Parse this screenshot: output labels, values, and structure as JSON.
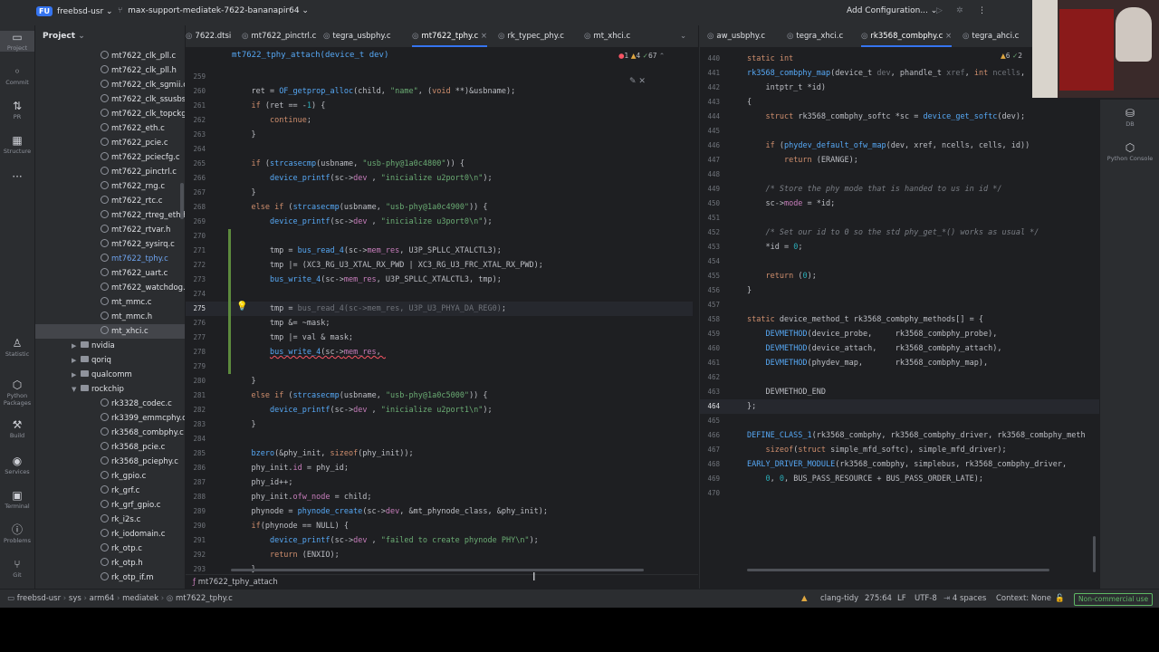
{
  "titlebar": {
    "app_badge": "FU",
    "project": "freebsd-usr",
    "branch": "max-support-mediatek-7622-bananapir64",
    "run_config": "Add Configuration..."
  },
  "left_sidebar": {
    "items": [
      {
        "label": "Project",
        "icon": "folder-icon"
      },
      {
        "label": "Commit",
        "icon": "commit-icon"
      },
      {
        "label": "PR",
        "icon": "pull-request-icon"
      },
      {
        "label": "Structure",
        "icon": "structure-icon"
      },
      {
        "label": "",
        "icon": "more-icon"
      },
      {
        "label": "Statistic",
        "icon": "statistic-icon"
      },
      {
        "label": "Python Packages",
        "icon": "python-packages-icon"
      },
      {
        "label": "Build",
        "icon": "build-icon"
      },
      {
        "label": "Services",
        "icon": "services-icon"
      },
      {
        "label": "Terminal",
        "icon": "terminal-icon"
      },
      {
        "label": "Problems",
        "icon": "problems-icon"
      },
      {
        "label": "Git",
        "icon": "git-icon"
      }
    ]
  },
  "right_sidebar": {
    "items": [
      {
        "label": "DB",
        "icon": "database-icon"
      },
      {
        "label": "Python Console",
        "icon": "python-console-icon"
      }
    ]
  },
  "project_panel": {
    "title": "Project",
    "rows": [
      {
        "label": "mt7622_clk_pll.c",
        "kind": "file",
        "indent": 1
      },
      {
        "label": "mt7622_clk_pll.h",
        "kind": "file",
        "indent": 1
      },
      {
        "label": "mt7622_clk_sgmii.c",
        "kind": "file",
        "indent": 1
      },
      {
        "label": "mt7622_clk_ssusbsys",
        "kind": "file",
        "indent": 1
      },
      {
        "label": "mt7622_clk_topckgen",
        "kind": "file",
        "indent": 1
      },
      {
        "label": "mt7622_eth.c",
        "kind": "file",
        "indent": 1
      },
      {
        "label": "mt7622_pcie.c",
        "kind": "file",
        "indent": 1
      },
      {
        "label": "mt7622_pciecfg.c",
        "kind": "file",
        "indent": 1
      },
      {
        "label": "mt7622_pinctrl.c",
        "kind": "file",
        "indent": 1
      },
      {
        "label": "mt7622_rng.c",
        "kind": "file",
        "indent": 1
      },
      {
        "label": "mt7622_rtc.c",
        "kind": "file",
        "indent": 1
      },
      {
        "label": "mt7622_rtreg_eth.h",
        "kind": "file",
        "indent": 1
      },
      {
        "label": "mt7622_rtvar.h",
        "kind": "file",
        "indent": 1
      },
      {
        "label": "mt7622_sysirq.c",
        "kind": "file",
        "indent": 1
      },
      {
        "label": "mt7622_tphy.c",
        "kind": "file",
        "indent": 1,
        "highlight": true
      },
      {
        "label": "mt7622_uart.c",
        "kind": "file",
        "indent": 1
      },
      {
        "label": "mt7622_watchdog.c",
        "kind": "file",
        "indent": 1
      },
      {
        "label": "mt_mmc.c",
        "kind": "file",
        "indent": 1
      },
      {
        "label": "mt_mmc.h",
        "kind": "file",
        "indent": 1
      },
      {
        "label": "mt_xhci.c",
        "kind": "file",
        "indent": 1,
        "selected": true
      },
      {
        "label": "nvidia",
        "kind": "dir",
        "indent": 0,
        "chev": "▶"
      },
      {
        "label": "qoriq",
        "kind": "dir",
        "indent": 0,
        "chev": "▶"
      },
      {
        "label": "qualcomm",
        "kind": "dir",
        "indent": 0,
        "chev": "▶"
      },
      {
        "label": "rockchip",
        "kind": "dir",
        "indent": 0,
        "chev": "▼"
      },
      {
        "label": "rk3328_codec.c",
        "kind": "file",
        "indent": 1
      },
      {
        "label": "rk3399_emmcphy.c",
        "kind": "file",
        "indent": 1
      },
      {
        "label": "rk3568_combphy.c",
        "kind": "file",
        "indent": 1
      },
      {
        "label": "rk3568_pcie.c",
        "kind": "file",
        "indent": 1
      },
      {
        "label": "rk3568_pciephy.c",
        "kind": "file",
        "indent": 1
      },
      {
        "label": "rk_gpio.c",
        "kind": "file",
        "indent": 1
      },
      {
        "label": "rk_grf.c",
        "kind": "file",
        "indent": 1
      },
      {
        "label": "rk_grf_gpio.c",
        "kind": "file",
        "indent": 1
      },
      {
        "label": "rk_i2s.c",
        "kind": "file",
        "indent": 1
      },
      {
        "label": "rk_iodomain.c",
        "kind": "file",
        "indent": 1
      },
      {
        "label": "rk_otp.c",
        "kind": "file",
        "indent": 1
      },
      {
        "label": "rk_otp.h",
        "kind": "file",
        "indent": 1
      },
      {
        "label": "rk_otp_if.m",
        "kind": "file",
        "indent": 1
      }
    ]
  },
  "left_editor": {
    "tabs": [
      {
        "label": "7622.dtsi",
        "active": false
      },
      {
        "label": "mt7622_pinctrl.c",
        "active": false
      },
      {
        "label": "tegra_usbphy.c",
        "active": false
      },
      {
        "label": "mt7622_tphy.c",
        "active": true
      },
      {
        "label": "rk_typec_phy.c",
        "active": false
      },
      {
        "label": "mt_xhci.c",
        "active": false
      }
    ],
    "breadcrumb": "mt7622_tphy_attach(device_t dev)",
    "inspections": {
      "errors": "1",
      "warnings": "4",
      "weak": "67"
    },
    "lines": [
      {
        "n": "259",
        "html": ""
      },
      {
        "n": "260",
        "html": "    ret = <span class=\"fn\">OF_getprop_alloc</span>(child, <span class=\"str\">\"name\"</span>, (<span class=\"kw\">void</span> **)&amp;usbname);"
      },
      {
        "n": "261",
        "html": "    <span class=\"kw\">if</span> (ret == -<span class=\"num\">1</span>) {"
      },
      {
        "n": "262",
        "html": "        <span class=\"kw\">continue</span>;"
      },
      {
        "n": "263",
        "html": "    }"
      },
      {
        "n": "264",
        "html": ""
      },
      {
        "n": "265",
        "html": "    <span class=\"kw\">if</span> (<span class=\"fn\">strcasecmp</span>(usbname, <span class=\"str\">\"usb-phy@1a0c4800\"</span>)) {"
      },
      {
        "n": "266",
        "html": "        <span class=\"fn\">device_printf</span>(sc-&gt;<span class=\"fld\">dev</span> , <span class=\"str\">\"inicialize u2port0\\n\"</span>);"
      },
      {
        "n": "267",
        "html": "    }"
      },
      {
        "n": "268",
        "html": "    <span class=\"kw\">else if</span> (<span class=\"fn\">strcasecmp</span>(usbname, <span class=\"str\">\"usb-phy@1a0c4900\"</span>)) {"
      },
      {
        "n": "269",
        "html": "        <span class=\"fn\">device_printf</span>(sc-&gt;<span class=\"fld\">dev</span> , <span class=\"str\">\"inicialize u3port0\\n\"</span>);"
      },
      {
        "n": "270",
        "html": ""
      },
      {
        "n": "271",
        "html": "        tmp = <span class=\"fn\">bus_read_4</span>(sc-&gt;<span class=\"fld\">mem_res</span>, U3P_SPLLC_XTALCTL3);"
      },
      {
        "n": "272",
        "html": "        tmp |= (XC3_RG_U3_XTAL_RX_PWD | XC3_RG_U3_FRC_XTAL_RX_PWD);"
      },
      {
        "n": "273",
        "html": "        <span class=\"fn\">bus_write_4</span>(sc-&gt;<span class=\"fld\">mem_res</span>, U3P_SPLLC_XTALCTL3, tmp);"
      },
      {
        "n": "274",
        "html": ""
      },
      {
        "n": "275",
        "html": "        tmp = <span class=\"dim\">bus_read_4(sc-&gt;mem_res, U3P_U3_PHYA_DA_REG0)</span>;",
        "current": true
      },
      {
        "n": "276",
        "html": "        tmp &amp;= ~mask;"
      },
      {
        "n": "277",
        "html": "        tmp |= val &amp; mask;"
      },
      {
        "n": "278",
        "html": "        <span class=\"err\"><span class=\"fn\">bus_write_4</span>(sc-&gt;<span class=\"fld\">mem_res</span>, </span>"
      },
      {
        "n": "279",
        "html": ""
      },
      {
        "n": "280",
        "html": "    }"
      },
      {
        "n": "281",
        "html": "    <span class=\"kw\">else if</span> (<span class=\"fn\">strcasecmp</span>(usbname, <span class=\"str\">\"usb-phy@1a0c5000\"</span>)) {"
      },
      {
        "n": "282",
        "html": "        <span class=\"fn\">device_printf</span>(sc-&gt;<span class=\"fld\">dev</span> , <span class=\"str\">\"inicialize u2port1\\n\"</span>);"
      },
      {
        "n": "283",
        "html": "    }"
      },
      {
        "n": "284",
        "html": ""
      },
      {
        "n": "285",
        "html": "    <span class=\"fn\">bzero</span>(&amp;phy_init, <span class=\"kw\">sizeof</span>(phy_init));"
      },
      {
        "n": "286",
        "html": "    phy_init.<span class=\"fld\">id</span> = phy_id;"
      },
      {
        "n": "287",
        "html": "    phy_id++;"
      },
      {
        "n": "288",
        "html": "    phy_init.<span class=\"fld\">ofw_node</span> = child;"
      },
      {
        "n": "289",
        "html": "    phynode = <span class=\"fn\">phynode_create</span>(sc-&gt;<span class=\"fld\">dev</span>, &amp;mt_phynode_class, &amp;phy_init);"
      },
      {
        "n": "290",
        "html": "    <span class=\"kw\">if</span>(phynode == NULL) {"
      },
      {
        "n": "291",
        "html": "        <span class=\"fn\">device_printf</span>(sc-&gt;<span class=\"fld\">dev</span> , <span class=\"str\">\"failed to create phynode PHY\\n\"</span>);"
      },
      {
        "n": "292",
        "html": "        <span class=\"kw\">return</span> (ENXIO);"
      },
      {
        "n": "293",
        "html": "    }"
      }
    ],
    "footer_crumb": "mt7622_tphy_attach"
  },
  "right_editor": {
    "tabs": [
      {
        "label": "aw_usbphy.c",
        "active": false
      },
      {
        "label": "tegra_xhci.c",
        "active": false
      },
      {
        "label": "rk3568_combphy.c",
        "active": true
      },
      {
        "label": "tegra_ahci.c",
        "active": false
      }
    ],
    "inspections": {
      "warnings": "6",
      "weak": "2"
    },
    "lines": [
      {
        "n": "440",
        "html": "<span class=\"kw\">static int</span>"
      },
      {
        "n": "441",
        "html": "<span class=\"fn\">rk3568_combphy_map</span>(device_t <span class=\"dim\">dev</span>, phandle_t <span class=\"dim\">xref</span>, <span class=\"kw\">int</span> <span class=\"dim\">ncells</span>,"
      },
      {
        "n": "442",
        "html": "    intptr_t *id)"
      },
      {
        "n": "443",
        "html": "{"
      },
      {
        "n": "444",
        "html": "    <span class=\"kw\">struct</span> rk3568_combphy_softc *sc = <span class=\"fn\">device_get_softc</span>(dev);"
      },
      {
        "n": "445",
        "html": ""
      },
      {
        "n": "446",
        "html": "    <span class=\"kw\">if</span> (<span class=\"fn\">phydev_default_ofw_map</span>(dev, xref, ncells, cells, id))"
      },
      {
        "n": "447",
        "html": "        <span class=\"kw\">return</span> (ERANGE);"
      },
      {
        "n": "448",
        "html": ""
      },
      {
        "n": "449",
        "html": "    <span class=\"cm\">/* Store the phy mode that is handed to us in id */</span>"
      },
      {
        "n": "450",
        "html": "    sc-&gt;<span class=\"fld\">mode</span> = *id;"
      },
      {
        "n": "451",
        "html": ""
      },
      {
        "n": "452",
        "html": "    <span class=\"cm\">/* Set our id to 0 so the std phy_get_*() works as usual */</span>"
      },
      {
        "n": "453",
        "html": "    *id = <span class=\"num\">0</span>;"
      },
      {
        "n": "454",
        "html": ""
      },
      {
        "n": "455",
        "html": "    <span class=\"kw\">return</span> (<span class=\"num\">0</span>);"
      },
      {
        "n": "456",
        "html": "}"
      },
      {
        "n": "457",
        "html": ""
      },
      {
        "n": "458",
        "html": "<span class=\"kw\">static</span> device_method_t rk3568_combphy_methods[] = {"
      },
      {
        "n": "459",
        "html": "    <span class=\"fn\">DEVMETHOD</span>(device_probe,     rk3568_combphy_probe),"
      },
      {
        "n": "460",
        "html": "    <span class=\"fn\">DEVMETHOD</span>(device_attach,    rk3568_combphy_attach),"
      },
      {
        "n": "461",
        "html": "    <span class=\"fn\">DEVMETHOD</span>(phydev_map,       rk3568_combphy_map),"
      },
      {
        "n": "462",
        "html": ""
      },
      {
        "n": "463",
        "html": "    DEVMETHOD_END"
      },
      {
        "n": "464",
        "html": "};",
        "current": true
      },
      {
        "n": "465",
        "html": ""
      },
      {
        "n": "466",
        "html": "<span class=\"fn\">DEFINE_CLASS_1</span>(rk3568_combphy, rk3568_combphy_driver, rk3568_combphy_meth"
      },
      {
        "n": "467",
        "html": "    <span class=\"kw\">sizeof</span>(<span class=\"kw\">struct</span> simple_mfd_softc), simple_mfd_driver);"
      },
      {
        "n": "468",
        "html": "<span class=\"fn\">EARLY_DRIVER_MODULE</span>(rk3568_combphy, simplebus, rk3568_combphy_driver,"
      },
      {
        "n": "469",
        "html": "    <span class=\"num\">0</span>, <span class=\"num\">0</span>, BUS_PASS_RESOURCE + BUS_PASS_ORDER_LATE);"
      },
      {
        "n": "470",
        "html": ""
      }
    ]
  },
  "statusbar": {
    "path": [
      "freebsd-usr",
      "sys",
      "arm64",
      "mediatek",
      "mt7622_tphy.c"
    ],
    "linter": "clang-tidy",
    "position": "275:64",
    "line_ending": "LF",
    "encoding": "UTF-8",
    "indent": "4 spaces",
    "context": "Context: None",
    "license": "Non-commercial use"
  }
}
